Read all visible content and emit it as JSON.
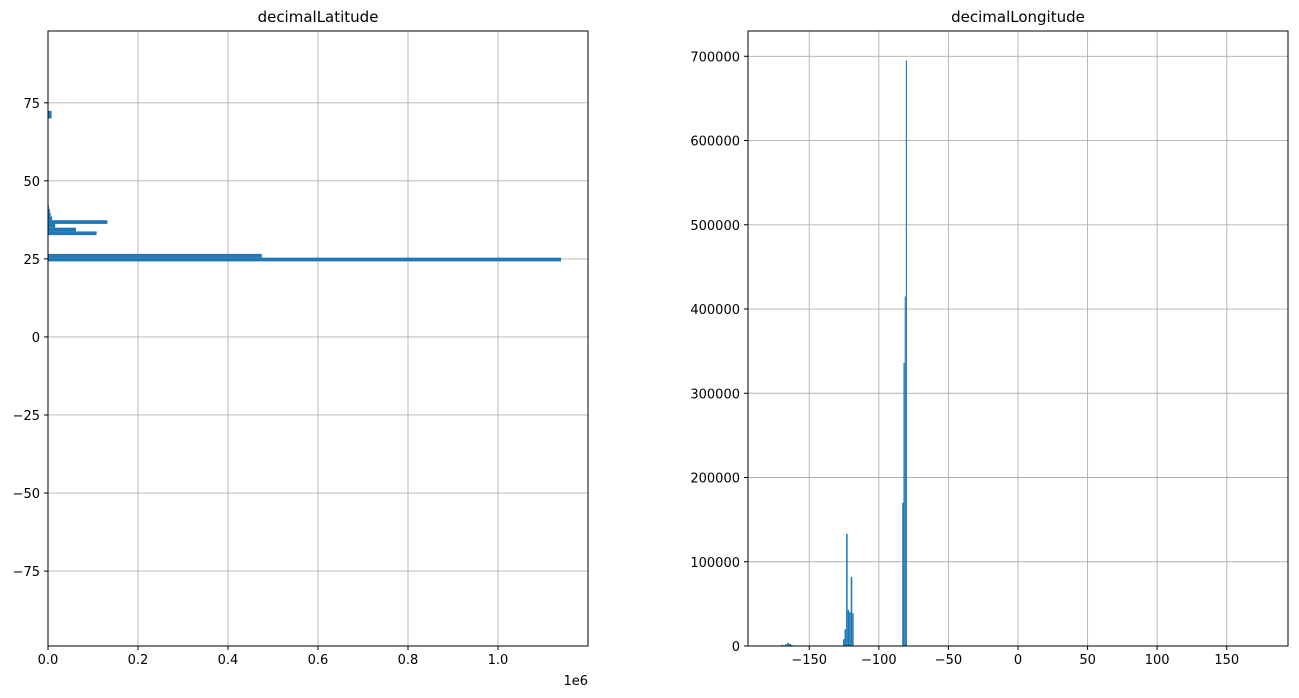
{
  "chart_data": [
    {
      "type": "bar",
      "orientation": "horizontal",
      "title": "decimalLatitude",
      "x_offset_label": "1e6",
      "xlim": [
        0,
        1.2
      ],
      "ylim": [
        -99,
        98
      ],
      "x_ticks": [
        0,
        0.2,
        0.4,
        0.6,
        0.8,
        1.0
      ],
      "x_tick_labels": [
        "0.0",
        "0.2",
        "0.4",
        "0.6",
        "0.8",
        "1.0"
      ],
      "y_ticks": [
        75,
        50,
        25,
        0,
        -25,
        -50,
        -75
      ],
      "y_tick_labels": [
        "75",
        "50",
        "25",
        "0",
        "−25",
        "−50",
        "−75"
      ],
      "grid": true,
      "color": "#1f77b4",
      "bins": [
        {
          "lo": 24.2,
          "hi": 25.4,
          "count": 1.14
        },
        {
          "lo": 25.4,
          "hi": 26.6,
          "count": 0.475
        },
        {
          "lo": 32.6,
          "hi": 33.8,
          "count": 0.108
        },
        {
          "lo": 33.8,
          "hi": 35.0,
          "count": 0.062
        },
        {
          "lo": 35.0,
          "hi": 36.2,
          "count": 0.016
        },
        {
          "lo": 36.2,
          "hi": 37.4,
          "count": 0.132
        },
        {
          "lo": 37.4,
          "hi": 38.6,
          "count": 0.009
        },
        {
          "lo": 38.6,
          "hi": 39.8,
          "count": 0.006
        },
        {
          "lo": 39.8,
          "hi": 41.0,
          "count": 0.004
        },
        {
          "lo": 41.0,
          "hi": 42.2,
          "count": 0.002
        },
        {
          "lo": 70.0,
          "hi": 71.2,
          "count": 0.008
        },
        {
          "lo": 71.2,
          "hi": 72.4,
          "count": 0.008
        }
      ]
    },
    {
      "type": "bar",
      "title": "decimalLongitude",
      "xlim": [
        -194,
        194
      ],
      "ylim": [
        0,
        730000
      ],
      "x_ticks": [
        -150,
        -100,
        -50,
        0,
        50,
        100,
        150
      ],
      "x_tick_labels": [
        "−150",
        "−100",
        "−50",
        "0",
        "50",
        "100",
        "150"
      ],
      "y_ticks": [
        0,
        100000,
        200000,
        300000,
        400000,
        500000,
        600000,
        700000
      ],
      "y_tick_labels": [
        "0",
        "100000",
        "200000",
        "300000",
        "400000",
        "500000",
        "600000",
        "700000"
      ],
      "grid": true,
      "color": "#1f77b4",
      "bins": [
        {
          "lo": -170,
          "hi": -168.7,
          "count": 1500
        },
        {
          "lo": -167.5,
          "hi": -166.2,
          "count": 2000
        },
        {
          "lo": -165.9,
          "hi": -164.6,
          "count": 3500
        },
        {
          "lo": -164.6,
          "hi": -163.3,
          "count": 2500
        },
        {
          "lo": -163.3,
          "hi": -162,
          "count": 1500
        },
        {
          "lo": -125.7,
          "hi": -124.6,
          "count": 8000
        },
        {
          "lo": -124.6,
          "hi": -123.5,
          "count": 20000
        },
        {
          "lo": -123.5,
          "hi": -122.4,
          "count": 133000
        },
        {
          "lo": -122.4,
          "hi": -121.3,
          "count": 43000
        },
        {
          "lo": -121.3,
          "hi": -120.2,
          "count": 40000
        },
        {
          "lo": -120.2,
          "hi": -119.1,
          "count": 82000
        },
        {
          "lo": -119.1,
          "hi": -118.1,
          "count": 39000
        },
        {
          "lo": -83.2,
          "hi": -82.3,
          "count": 170000
        },
        {
          "lo": -82.3,
          "hi": -81.4,
          "count": 336000
        },
        {
          "lo": -81.4,
          "hi": -80.6,
          "count": 415000
        },
        {
          "lo": -80.6,
          "hi": -79.8,
          "count": 695000
        }
      ]
    }
  ]
}
